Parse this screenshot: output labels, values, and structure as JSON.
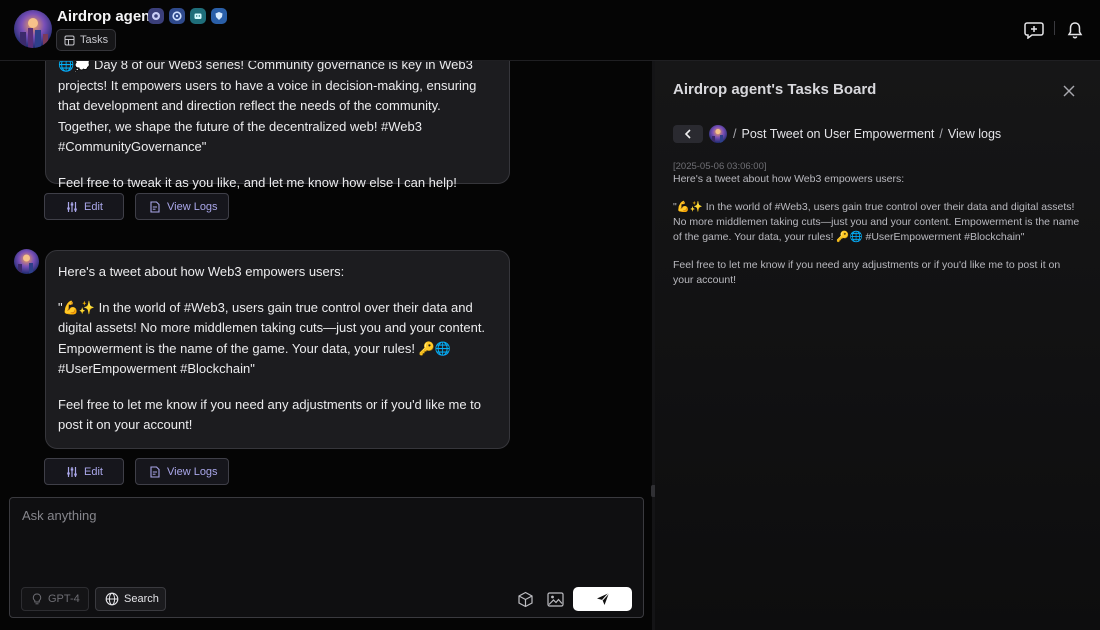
{
  "header": {
    "agent_name": "Airdrop agent",
    "tasks_label": "Tasks",
    "badges": [
      "robot-badge",
      "gear-badge",
      "bot-badge",
      "shield-badge"
    ]
  },
  "messages": [
    {
      "partial": true,
      "paragraphs": [
        "🌐💭 Day 8 of our Web3 series! Community governance is key in Web3 projects! It empowers users to have a voice in decision-making, ensuring that development and direction reflect the needs of the community. Together, we shape the future of the decentralized web! #Web3 #CommunityGovernance\"",
        "Feel free to tweak it as you like, and let me know how else I can help!"
      ],
      "edit_label": "Edit",
      "logs_label": "View Logs"
    },
    {
      "partial": false,
      "paragraphs": [
        "Here's a tweet about how Web3 empowers users:",
        "\"💪✨ In the world of #Web3, users gain true control over their data and digital assets! No more middlemen taking cuts—just you and your content. Empowerment is the name of the game. Your data, your rules! 🔑🌐 #UserEmpowerment #Blockchain\"",
        "Feel free to let me know if you need any adjustments or if you'd like me to post it on your account!"
      ],
      "edit_label": "Edit",
      "logs_label": "View Logs"
    }
  ],
  "composer": {
    "placeholder": "Ask anything",
    "model_label": "GPT-4",
    "search_label": "Search",
    "icons": [
      "cube-icon",
      "image-icon",
      "send-icon"
    ]
  },
  "panel": {
    "title": "Airdrop agent's Tasks Board",
    "breadcrumb": [
      "Post Tweet on User Empowerment",
      "View logs"
    ],
    "log": {
      "timestamp": "[2025-05-06 03:06:00]",
      "lines": [
        "Here's a tweet about how Web3 empowers users:",
        "\"💪✨ In the world of #Web3, users gain true control over their data and digital assets! No more middlemen taking cuts—just you and your content. Empowerment is the name of the game. Your data, your rules! 🔑🌐 #UserEmpowerment #Blockchain\"",
        "Feel free to let me know if you need any adjustments or if you'd like me to post it on your account!"
      ]
    }
  },
  "colors": {
    "accent_text": "#a9a6e9",
    "bubble_bg": "#1c1c1f",
    "page_bg": "#050505",
    "panel_bg": "#161617"
  }
}
